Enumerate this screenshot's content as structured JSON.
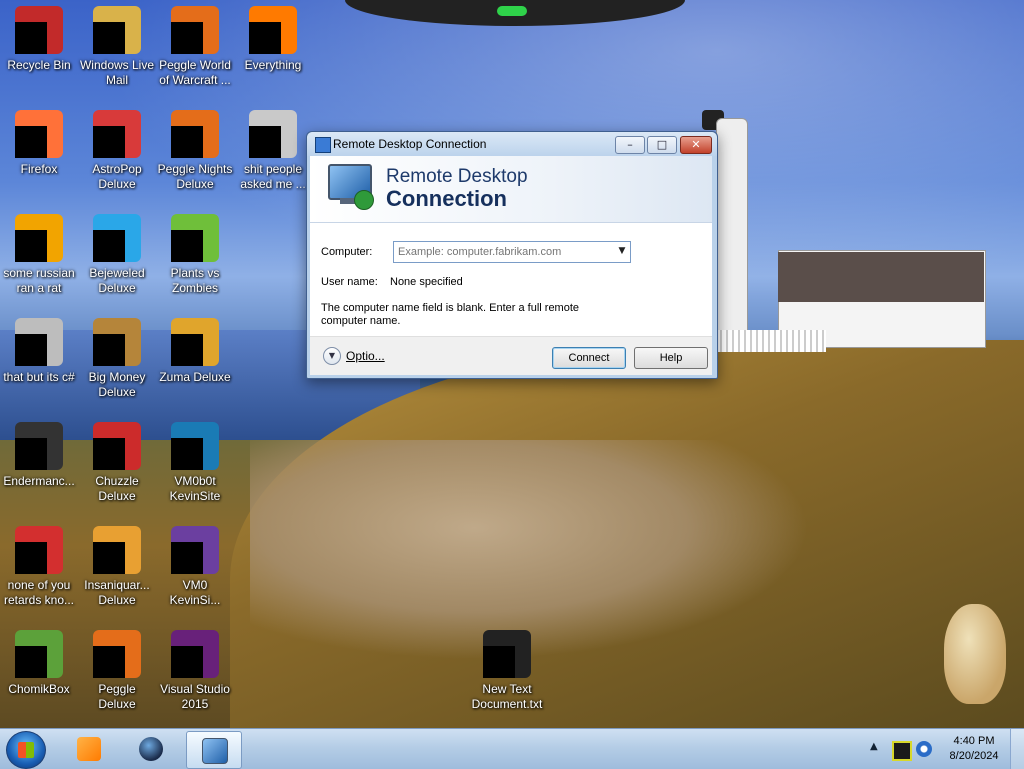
{
  "desktop": {
    "icons": [
      {
        "label": "Recycle Bin",
        "icon": "recycle-bin-icon",
        "color": "#c22a2a"
      },
      {
        "label": "Windows Live Mail",
        "icon": "mail-icon",
        "color": "#d9b24a"
      },
      {
        "label": "Peggle World of Warcraft ...",
        "icon": "peggle-icon",
        "color": "#e46d1a"
      },
      {
        "label": "Everything",
        "icon": "search-icon",
        "color": "#ff7a00"
      },
      {
        "label": "Firefox",
        "icon": "firefox-icon",
        "color": "#ff7139"
      },
      {
        "label": "AstroPop Deluxe",
        "icon": "astropop-icon",
        "color": "#d83a3a"
      },
      {
        "label": "Peggle Nights Deluxe",
        "icon": "peggle-icon",
        "color": "#e46d1a"
      },
      {
        "label": "shit people asked me ...",
        "icon": "folder-icon",
        "color": "#c9c9c9"
      },
      {
        "label": "some russian ran a rat",
        "icon": "document-icon",
        "color": "#f2a400"
      },
      {
        "label": "Bejeweled Deluxe",
        "icon": "gem-icon",
        "color": "#2aa7e8"
      },
      {
        "label": "Plants vs Zombies",
        "icon": "flower-icon",
        "color": "#6fbf3a"
      },
      {
        "label": "that but its c#",
        "icon": "copy-icon",
        "color": "#bdbdbd"
      },
      {
        "label": "Big Money Deluxe",
        "icon": "moneybag-icon",
        "color": "#b5853a"
      },
      {
        "label": "Zuma Deluxe",
        "icon": "zuma-icon",
        "color": "#e0a52c"
      },
      {
        "label": "Endermanc...",
        "icon": "console-icon",
        "color": "#333333"
      },
      {
        "label": "Chuzzle Deluxe",
        "icon": "chuzzle-icon",
        "color": "#cc2b2b"
      },
      {
        "label": "VM0b0t KevinSite",
        "icon": "vm-icon",
        "color": "#1a7bb5"
      },
      {
        "label": "none of you retards kno...",
        "icon": "opera-icon",
        "color": "#d32f2f"
      },
      {
        "label": "Insaniquar... Deluxe",
        "icon": "insaniquarium-icon",
        "color": "#e8a032"
      },
      {
        "label": "VM0 KevinSi...",
        "icon": "vm-icon",
        "color": "#6b3fa0"
      },
      {
        "label": "ChomikBox",
        "icon": "chomikbox-icon",
        "color": "#5ca13a"
      },
      {
        "label": "Peggle Deluxe",
        "icon": "peggle-icon",
        "color": "#e46d1a"
      },
      {
        "label": "Visual Studio 2015",
        "icon": "visual-studio-icon",
        "color": "#68217a"
      },
      {
        "label": "New Text Document.txt",
        "icon": "text-file-icon",
        "color": "#222222"
      }
    ]
  },
  "rdc_window": {
    "title": "Remote Desktop Connection",
    "banner_line1": "Remote Desktop",
    "banner_line2": "Connection",
    "computer_label": "Computer:",
    "computer_value": "",
    "computer_placeholder": "Example: computer.fabrikam.com",
    "username_label": "User name:",
    "username_value": "None specified",
    "message": "The computer name field is blank. Enter a full remote computer name.",
    "options_label": "Optio...",
    "connect_label": "Connect",
    "help_label": "Help"
  },
  "taskbar": {
    "clock_time": "4:40 PM",
    "clock_date": "8/20/2024"
  }
}
